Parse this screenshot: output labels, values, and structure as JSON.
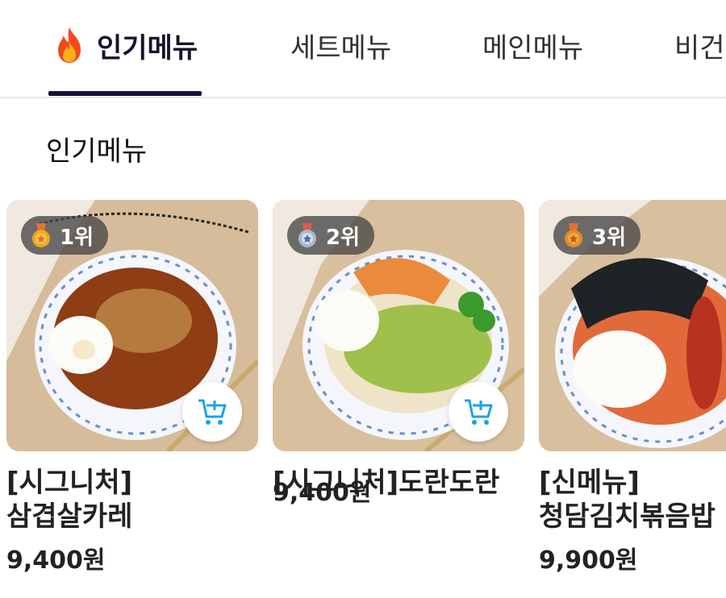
{
  "tabs": [
    {
      "label": "인기메뉴",
      "icon": "fire-icon",
      "active": true
    },
    {
      "label": "세트메뉴",
      "active": false
    },
    {
      "label": "메인메뉴",
      "active": false
    },
    {
      "label": "비건",
      "active": false
    }
  ],
  "section_title": "인기메뉴",
  "colors": {
    "accent": "#14143a",
    "cart_blue": "#1aa3e8",
    "badge_bg": "#464646"
  },
  "products": [
    {
      "rank": "1위",
      "medal": "gold-medal-icon",
      "name_line1": "[시그니처]",
      "name_line2": "삼겹살카레",
      "price": "9,400원",
      "cart_icon": "add-to-cart-icon"
    },
    {
      "rank": "2위",
      "medal": "silver-medal-icon",
      "name_line1": "[시그니처]도란도란",
      "name_line2": "",
      "price": "9,400원",
      "cart_icon": "add-to-cart-icon"
    },
    {
      "rank": "3위",
      "medal": "bronze-medal-icon",
      "name_line1": "[신메뉴]",
      "name_line2": "청담김치볶음밥",
      "price": "9,900원",
      "cart_icon": "add-to-cart-icon"
    }
  ]
}
